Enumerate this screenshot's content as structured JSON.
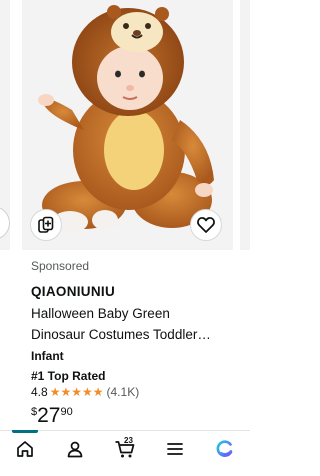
{
  "product": {
    "sponsored_label": "Sponsored",
    "brand": "QIAONIUNIU",
    "title_line1": "Halloween Baby Green",
    "title_line2": "Dinosaur Costumes Toddler…",
    "variant": "Infant",
    "badge": "#1 Top Rated",
    "rating": "4.8",
    "stars_filled": 4.8,
    "review_count": "(4.1K)",
    "price_symbol": "$",
    "price_whole": "27",
    "price_fraction": "90",
    "image_description_icon": "lion-costume-photo"
  },
  "actions": {
    "compare_icon": "compare-icon",
    "wishlist_icon": "heart-icon"
  },
  "nav": {
    "items": [
      {
        "icon": "home-icon",
        "active": true
      },
      {
        "icon": "account-icon",
        "active": false
      },
      {
        "icon": "cart-icon",
        "active": false,
        "count": "23"
      },
      {
        "icon": "menu-icon",
        "active": false
      },
      {
        "icon": "assistant-icon",
        "active": false
      }
    ]
  },
  "colors": {
    "star": "#f18d29",
    "accent": "#007185",
    "assistant_gradient_start": "#1ec8e6",
    "assistant_gradient_end": "#7a4cff"
  }
}
